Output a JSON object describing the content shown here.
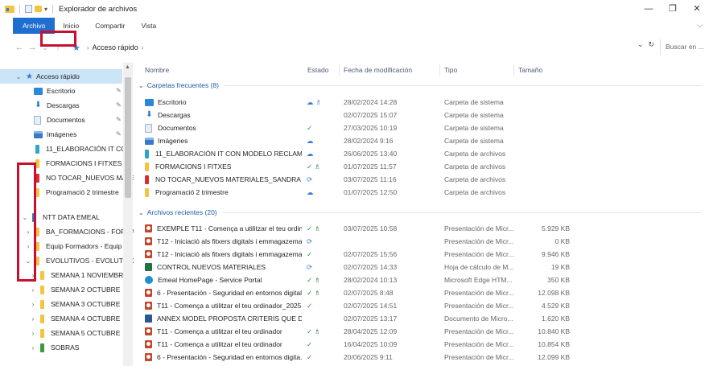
{
  "window": {
    "title": "Explorador de archivos",
    "controls": {
      "minimize": "—",
      "maximize": "❐",
      "close": "✕"
    }
  },
  "ribbon": {
    "tabs": [
      "Archivo",
      "Inicio",
      "Compartir",
      "Vista"
    ],
    "expand_icon": "chevron-down"
  },
  "address": {
    "crumb": "Acceso rápido",
    "search_placeholder": "Buscar en ..."
  },
  "nav": {
    "items": [
      {
        "label": "Acceso rápido",
        "icon": "star-icon",
        "chevron": "⌄",
        "pinned": false
      },
      {
        "label": "Escritorio",
        "icon": "desktop-icon",
        "pinned": true
      },
      {
        "label": "Descargas",
        "icon": "download-icon",
        "pinned": true
      },
      {
        "label": "Documentos",
        "icon": "document-icon",
        "pinned": true
      },
      {
        "label": "Imágenes",
        "icon": "image-icon",
        "pinned": true
      },
      {
        "label": "11_ELABORACIÓN IT CON",
        "icon": "teal-folder-icon"
      },
      {
        "label": "FORMACIONS I FITXES",
        "icon": "folder-icon"
      },
      {
        "label": "NO TOCAR_NUEVOS MATE",
        "icon": "red-folder-icon"
      },
      {
        "label": "Programació 2 trimestre",
        "icon": "folder-icon"
      },
      {
        "label": "NTT DATA EMEAL",
        "icon": "ntt-icon",
        "chevron": "⌄"
      },
      {
        "label": "BA_FORMACIONS - FORMA",
        "icon": "folder-icon",
        "chevron": "›"
      },
      {
        "label": "Equip Formadors - Equip F",
        "icon": "folder-icon",
        "chevron": "›"
      },
      {
        "label": "EVOLUTIVOS - EVOLUTIVO",
        "icon": "folder-icon",
        "chevron": "⌄"
      },
      {
        "label": "SEMANA 1 NOVIEMBRE",
        "icon": "folder-icon",
        "chevron": "›"
      },
      {
        "label": "SEMANA 2 OCTUBRE",
        "icon": "folder-icon",
        "chevron": "›"
      },
      {
        "label": "SEMANA 3 OCTUBRE",
        "icon": "folder-icon",
        "chevron": "›"
      },
      {
        "label": "SEMANA 4 OCTUBRE",
        "icon": "folder-icon",
        "chevron": "›"
      },
      {
        "label": "SEMANA 5 OCTUBRE",
        "icon": "folder-icon",
        "chevron": "›"
      },
      {
        "label": "SOBRAS",
        "icon": "green-folder-icon",
        "chevron": "›"
      }
    ]
  },
  "columns": {
    "name": "Nombre",
    "state": "Estado",
    "date": "Fecha de modificación",
    "type": "Tipo",
    "size": "Tamaño"
  },
  "groups": {
    "frequent": "Carpetas frecuentes (8)",
    "recent": "Archivos recientes (20)"
  },
  "frequent_folders": [
    {
      "name": "Escritorio",
      "state": "☁ ♗",
      "date": "28/02/2024 14:28",
      "type": "Carpeta de sistema",
      "icon": "desktop-icon"
    },
    {
      "name": "Descargas",
      "state": "",
      "date": "02/07/2025 15:07",
      "type": "Carpeta de sistema",
      "icon": "download-icon"
    },
    {
      "name": "Documentos",
      "state": "✓",
      "date": "27/03/2025 10:19",
      "type": "Carpeta de sistema",
      "icon": "document-icon"
    },
    {
      "name": "Imágenes",
      "state": "☁",
      "date": "28/02/2024 9:16",
      "type": "Carpeta de sistema",
      "icon": "image-icon"
    },
    {
      "name": "11_ELABORACIÓN IT CON MODELO RECLAMA...",
      "state": "☁",
      "date": "26/06/2025 13:40",
      "type": "Carpeta de archivos",
      "icon": "teal-folder-icon"
    },
    {
      "name": "FORMACIONS I FITXES",
      "state": "✓ ♗",
      "date": "01/07/2025 11:57",
      "type": "Carpeta de archivos",
      "icon": "folder-icon"
    },
    {
      "name": "NO TOCAR_NUEVOS MATERIALES_SANDRA SE...",
      "state": "⟳",
      "date": "03/07/2025 11:16",
      "type": "Carpeta de archivos",
      "icon": "red-folder-icon"
    },
    {
      "name": "Programació 2 trimestre",
      "state": "☁",
      "date": "01/07/2025 12:50",
      "type": "Carpeta de archivos",
      "icon": "folder-icon"
    }
  ],
  "recent_files": [
    {
      "name": "EXEMPLE T11 - Comença a utilitzar el teu ordina...",
      "state": "✓ ♗",
      "date": "03/07/2025 10:58",
      "type": "Presentación de Micr...",
      "size": "5.929 KB",
      "icon": "powerpoint-icon"
    },
    {
      "name": "T12 - Iniciació als fitxers digitals i emmagazema...",
      "state": "⟳",
      "date": "",
      "type": "Presentación de Micr...",
      "size": "0 KB",
      "icon": "powerpoint-icon"
    },
    {
      "name": "T12 - Iniciació als fitxers digitals i emmagazema...",
      "state": "✓",
      "date": "02/07/2025 15:56",
      "type": "Presentación de Micr...",
      "size": "9.946 KB",
      "icon": "powerpoint-icon"
    },
    {
      "name": "CONTROL NUEVOS MATERIALES",
      "state": "⟳",
      "date": "02/07/2025 14:33",
      "type": "Hoja de cálculo de M...",
      "size": "19 KB",
      "icon": "excel-icon"
    },
    {
      "name": "Emeal HomePage - Service Portal",
      "state": "✓ ♗",
      "date": "28/02/2024 10:13",
      "type": "Microsoft Edge HTM...",
      "size": "350 KB",
      "icon": "edge-icon"
    },
    {
      "name": "6 - Presentación - Seguridad en entornos digital...",
      "state": "✓ ♗",
      "date": "02/07/2025 8:48",
      "type": "Presentación de Micr...",
      "size": "12.098 KB",
      "icon": "powerpoint-icon"
    },
    {
      "name": "T11 - Comença a utilitzar el teu ordinador_2025...",
      "state": "✓",
      "date": "02/07/2025 14:51",
      "type": "Presentación de Micr...",
      "size": "4.529 KB",
      "icon": "powerpoint-icon"
    },
    {
      "name": "ANNEX MODEL PROPOSTA CRITERIS QUE DEP...",
      "state": "",
      "date": "02/07/2025 13:17",
      "type": "Documento de Micro...",
      "size": "1.620 KB",
      "icon": "word-icon"
    },
    {
      "name": "T11 - Comença a utilitzar el teu ordinador",
      "state": "✓ ♗",
      "date": "28/04/2025 12:09",
      "type": "Presentación de Micr...",
      "size": "10.840 KB",
      "icon": "powerpoint-icon"
    },
    {
      "name": "T11 - Comença a utilitzar el teu ordinador",
      "state": "✓",
      "date": "16/04/2025 10:09",
      "type": "Presentación de Micr...",
      "size": "10.854 KB",
      "icon": "powerpoint-icon"
    },
    {
      "name": "6 - Presentación - Seguridad en entornos digita...",
      "state": "✓",
      "date": "20/06/2025 9:11",
      "type": "Presentación de Micr...",
      "size": "12.099 KB",
      "icon": "powerpoint-icon"
    }
  ],
  "colors": {
    "accent": "#1f6fd1",
    "selection": "#cce4f7",
    "highlight": "#c8102e"
  }
}
